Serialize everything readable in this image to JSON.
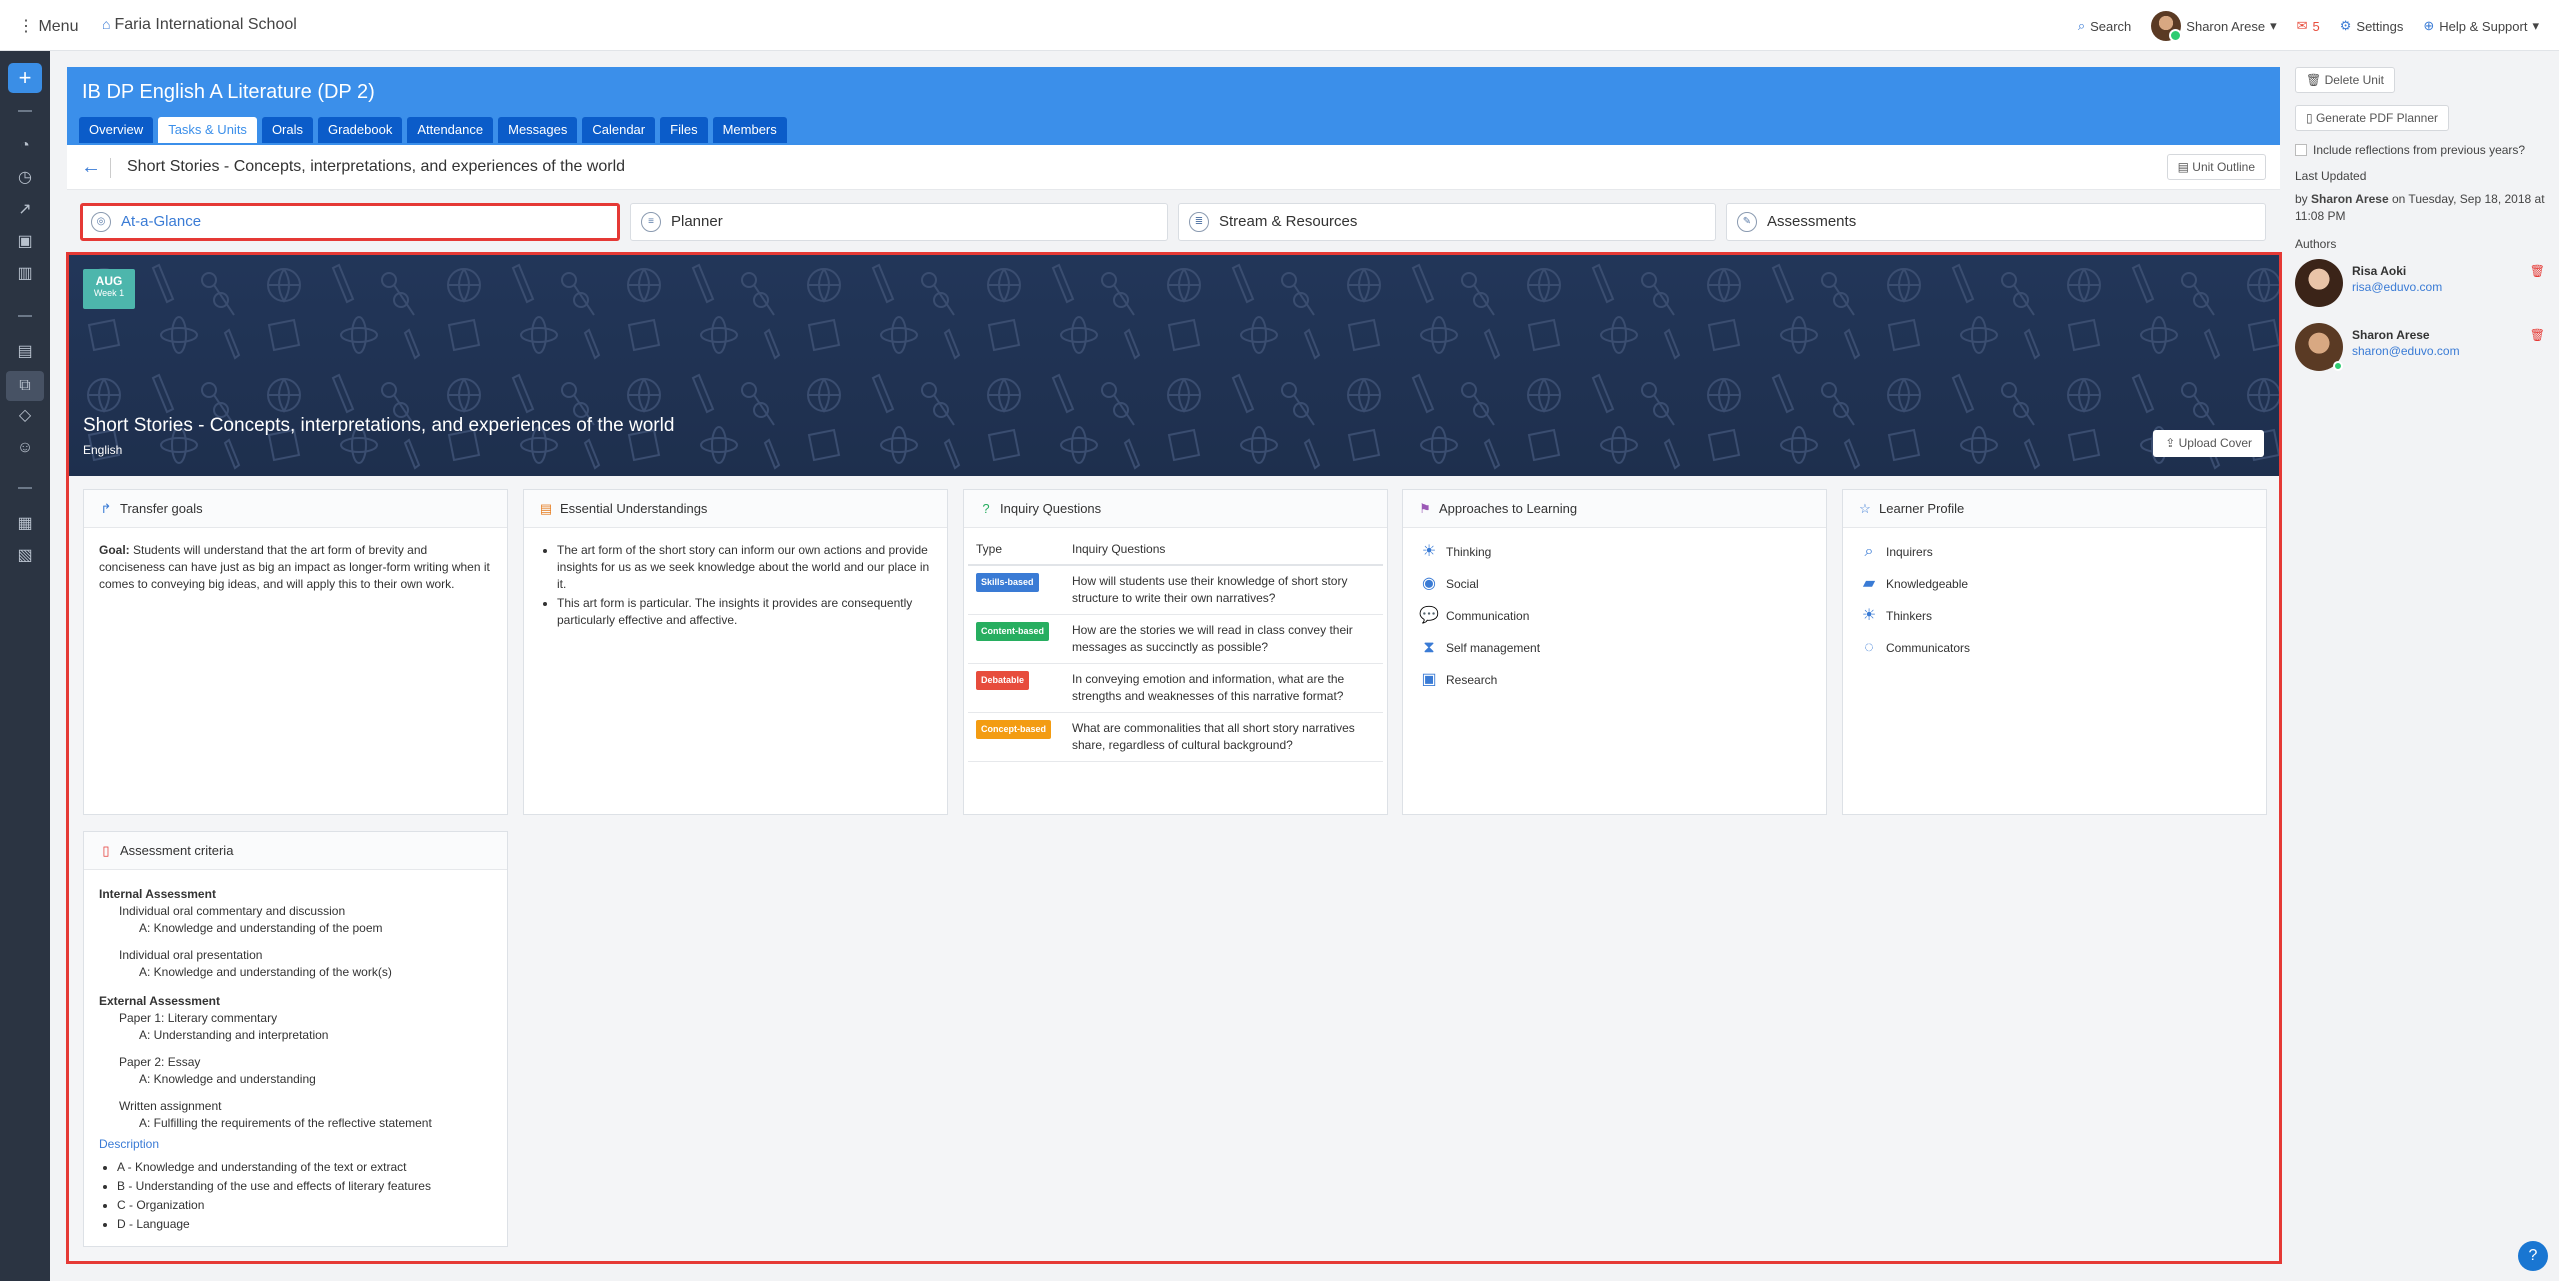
{
  "topbar": {
    "menu_label": "Menu",
    "school_name": "Faria International School",
    "search_label": "Search",
    "user_name": "Sharon Arese",
    "mail_count": "5",
    "settings_label": "Settings",
    "help_label": "Help & Support"
  },
  "class": {
    "title": "IB DP English A Literature (DP 2)",
    "tabs": [
      "Overview",
      "Tasks & Units",
      "Orals",
      "Gradebook",
      "Attendance",
      "Messages",
      "Calendar",
      "Files",
      "Members"
    ],
    "active_tab": "Tasks & Units"
  },
  "unit": {
    "title": "Short Stories - Concepts, interpretations, and experiences of the world",
    "outline_button": "Unit Outline"
  },
  "subnav": {
    "items": [
      "At-a-Glance",
      "Planner",
      "Stream & Resources",
      "Assessments"
    ],
    "active": "At-a-Glance"
  },
  "cover": {
    "month": "AUG",
    "week": "Week 1",
    "title": "Short Stories - Concepts, interpretations, and experiences of the world",
    "subject": "English",
    "upload_button": "Upload Cover",
    "color": "#1e2f4d"
  },
  "transfer_goals": {
    "title": "Transfer goals",
    "goal_label": "Goal:",
    "goal_text": "Students will understand that the art form of brevity and conciseness can have just as big an impact as longer-form writing when it comes to conveying big ideas, and will apply this to their own work."
  },
  "essential": {
    "title": "Essential Understandings",
    "items": [
      "The art form of the short story can inform our own actions and provide insights for us as we seek knowledge about the world and our place in it.",
      "This art form is particular. The insights it provides are consequently particularly effective and affective."
    ]
  },
  "inquiry": {
    "title": "Inquiry Questions",
    "col_type": "Type",
    "col_q": "Inquiry Questions",
    "rows": [
      {
        "type": "Skills-based",
        "color": "#3a7bd5",
        "q": "How will students use their knowledge of short story structure to write their own narratives?"
      },
      {
        "type": "Content-based",
        "color": "#27ae60",
        "q": "How are the stories we will read in class convey their messages as succinctly as possible?"
      },
      {
        "type": "Debatable",
        "color": "#e74c3c",
        "q": "In conveying emotion and information, what are the strengths and weaknesses of this narrative format?"
      },
      {
        "type": "Concept-based",
        "color": "#f39c12",
        "q": "What are commonalities that all short story narratives share, regardless of cultural background?"
      }
    ]
  },
  "atl": {
    "title": "Approaches to Learning",
    "items": [
      "Thinking",
      "Social",
      "Communication",
      "Self management",
      "Research"
    ]
  },
  "learner": {
    "title": "Learner Profile",
    "items": [
      "Inquirers",
      "Knowledgeable",
      "Thinkers",
      "Communicators"
    ]
  },
  "criteria": {
    "title": "Assessment criteria",
    "internal": "Internal Assessment",
    "ia1": "Individual oral commentary and discussion",
    "ia1a": "A: Knowledge and understanding of the poem",
    "ia2": "Individual oral presentation",
    "ia2a": "A: Knowledge and understanding of the work(s)",
    "external": "External Assessment",
    "ea1": "Paper 1: Literary commentary",
    "ea1a": "A: Understanding and interpretation",
    "ea2": "Paper 2: Essay",
    "ea2a": "A: Knowledge and understanding",
    "ea3": "Written assignment",
    "ea3a": "A: Fulfilling the requirements of the reflective statement",
    "description_label": "Description",
    "desc_items": [
      "A - Knowledge and understanding of the text or extract",
      "B - Understanding of the use and effects of literary features",
      "C - Organization",
      "D - Language"
    ]
  },
  "right": {
    "delete_unit": "Delete Unit",
    "generate_pdf": "Generate PDF Planner",
    "include_reflections": "Include reflections from previous years?",
    "last_updated_label": "Last Updated",
    "updated_by_prefix": "by",
    "updated_by": "Sharon Arese",
    "updated_on": "on Tuesday, Sep 18, 2018 at 11:08 PM",
    "authors_label": "Authors",
    "authors": [
      {
        "name": "Risa Aoki",
        "email": "risa@eduvo.com"
      },
      {
        "name": "Sharon Arese",
        "email": "sharon@eduvo.com"
      }
    ]
  }
}
